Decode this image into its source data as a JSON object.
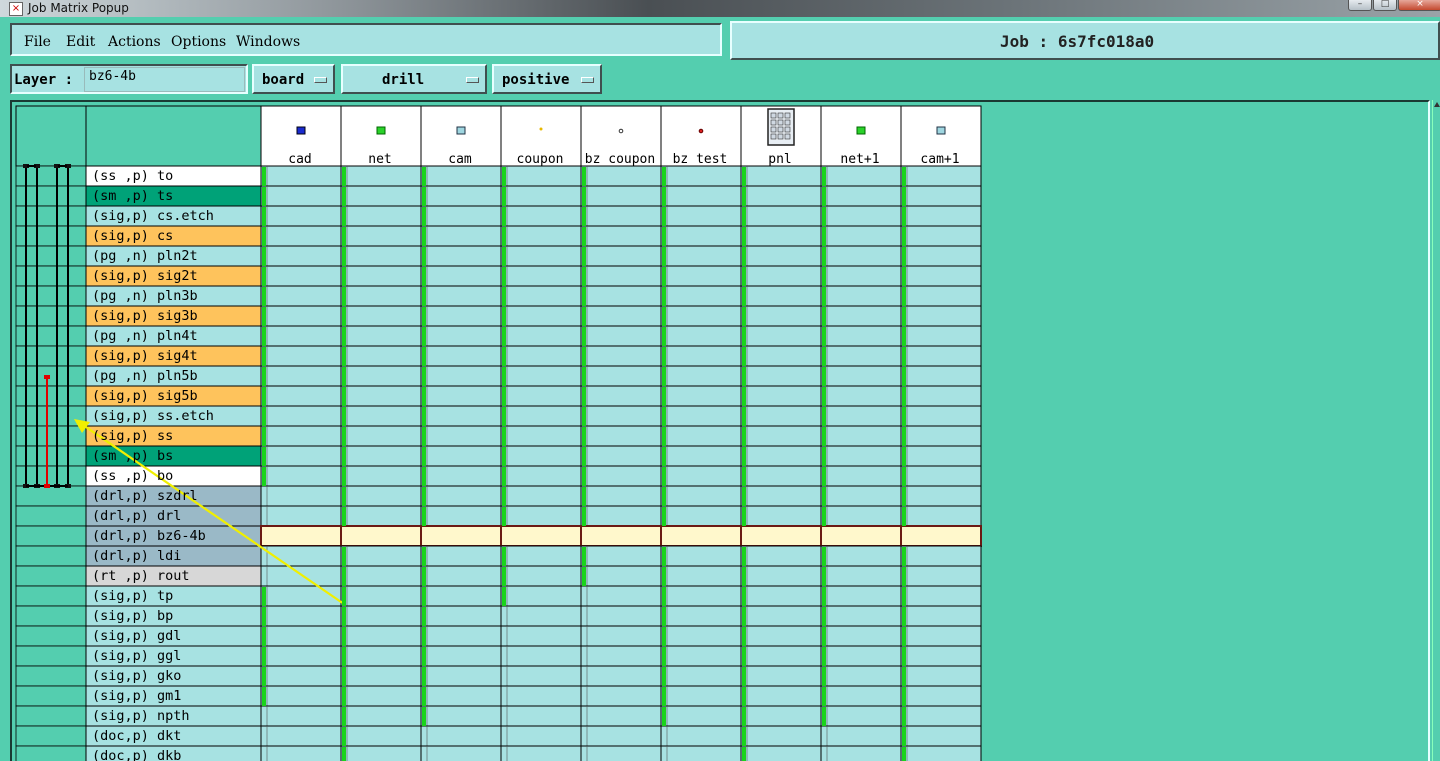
{
  "window": {
    "title": "Job Matrix Popup",
    "icon": "matrix-app-icon",
    "controls": [
      "minimize",
      "maximize",
      "close"
    ]
  },
  "menu": [
    "File",
    "Edit",
    "Actions",
    "Options",
    "Windows"
  ],
  "job": {
    "label": "Job",
    "separator": ":",
    "name": "6s7fc018a0"
  },
  "layer_field": {
    "label": "Layer :",
    "value": "bz6-4b"
  },
  "options": {
    "context": "board",
    "type": "drill",
    "polarity": "positive"
  },
  "steps": [
    {
      "name": "cad",
      "icon": "blue-square-icon"
    },
    {
      "name": "net",
      "icon": "green-square-icon"
    },
    {
      "name": "cam",
      "icon": "cyan-square-icon"
    },
    {
      "name": "coupon",
      "icon": "yellow-dot-icon"
    },
    {
      "name": "bz_coupon",
      "icon": "small-dot-icon"
    },
    {
      "name": "bz_test",
      "icon": "red-dot-icon"
    },
    {
      "name": "pnl",
      "icon": "panel-grid-icon"
    },
    {
      "name": "net+1",
      "icon": "green-square-icon"
    },
    {
      "name": "cam+1",
      "icon": "cyan-square-icon"
    }
  ],
  "colors": {
    "background": "#54ceaf",
    "cell": "#a7e2e2",
    "signal": "#fec35c",
    "mask": "#00a278",
    "silk": "#ffffff",
    "drill": "#9ab9c7",
    "rout": "#d7d7d7",
    "selected_cell": "#fff8cc",
    "tick": "#19d41c",
    "annotation": "#f0ef00",
    "drill_span": "#e00000"
  },
  "layers": [
    {
      "label": "(ss ,p) to",
      "kind": "silk",
      "ticks": [
        1,
        1,
        1,
        1,
        1,
        1,
        1,
        1,
        1
      ]
    },
    {
      "label": "(sm ,p) ts",
      "kind": "mask",
      "ticks": [
        1,
        1,
        1,
        1,
        1,
        1,
        1,
        1,
        1
      ]
    },
    {
      "label": "(sig,p) cs.etch",
      "kind": "plain",
      "ticks": [
        1,
        1,
        1,
        1,
        1,
        1,
        1,
        1,
        1
      ]
    },
    {
      "label": "(sig,p) cs",
      "kind": "signal",
      "ticks": [
        1,
        1,
        1,
        1,
        1,
        1,
        1,
        1,
        1
      ]
    },
    {
      "label": "(pg ,n) pln2t",
      "kind": "plain",
      "ticks": [
        1,
        1,
        1,
        1,
        1,
        1,
        1,
        1,
        1
      ]
    },
    {
      "label": "(sig,p) sig2t",
      "kind": "signal",
      "ticks": [
        1,
        1,
        1,
        1,
        1,
        1,
        1,
        1,
        1
      ]
    },
    {
      "label": "(pg ,n) pln3b",
      "kind": "plain",
      "ticks": [
        1,
        1,
        1,
        1,
        1,
        1,
        1,
        1,
        1
      ]
    },
    {
      "label": "(sig,p) sig3b",
      "kind": "signal",
      "ticks": [
        1,
        1,
        1,
        1,
        1,
        1,
        1,
        1,
        1
      ]
    },
    {
      "label": "(pg ,n) pln4t",
      "kind": "plain",
      "ticks": [
        1,
        1,
        1,
        1,
        1,
        1,
        1,
        1,
        1
      ]
    },
    {
      "label": "(sig,p) sig4t",
      "kind": "signal",
      "ticks": [
        1,
        1,
        1,
        1,
        1,
        1,
        1,
        1,
        1
      ]
    },
    {
      "label": "(pg ,n) pln5b",
      "kind": "plain",
      "ticks": [
        1,
        1,
        1,
        1,
        1,
        1,
        1,
        1,
        1
      ]
    },
    {
      "label": "(sig,p) sig5b",
      "kind": "signal",
      "ticks": [
        1,
        1,
        1,
        1,
        1,
        1,
        1,
        1,
        1
      ]
    },
    {
      "label": "(sig,p) ss.etch",
      "kind": "plain",
      "ticks": [
        1,
        1,
        1,
        1,
        1,
        1,
        1,
        1,
        1
      ]
    },
    {
      "label": "(sig,p) ss",
      "kind": "signal",
      "ticks": [
        1,
        1,
        1,
        1,
        1,
        1,
        1,
        1,
        1
      ]
    },
    {
      "label": "(sm ,p) bs",
      "kind": "mask",
      "ticks": [
        1,
        1,
        1,
        1,
        1,
        1,
        1,
        1,
        1
      ]
    },
    {
      "label": "(ss ,p) bo",
      "kind": "silk",
      "ticks": [
        1,
        1,
        1,
        1,
        1,
        1,
        1,
        1,
        1
      ]
    },
    {
      "label": "(drl,p) szdrl",
      "kind": "drill",
      "ticks": [
        0,
        1,
        1,
        1,
        1,
        1,
        1,
        1,
        1
      ]
    },
    {
      "label": "(drl,p) drl",
      "kind": "drill",
      "ticks": [
        0,
        1,
        1,
        1,
        1,
        1,
        1,
        1,
        1
      ]
    },
    {
      "label": "(drl,p) bz6-4b",
      "kind": "drill",
      "ticks": [
        0,
        0,
        0,
        0,
        0,
        0,
        0,
        0,
        0
      ],
      "selected": true
    },
    {
      "label": "(drl,p) ldi",
      "kind": "drill",
      "ticks": [
        0,
        1,
        1,
        1,
        1,
        1,
        1,
        1,
        1
      ]
    },
    {
      "label": "(rt ,p) rout",
      "kind": "rout",
      "ticks": [
        0,
        1,
        1,
        1,
        1,
        1,
        1,
        1,
        1
      ]
    },
    {
      "label": "(sig,p) tp",
      "kind": "plain",
      "ticks": [
        1,
        1,
        1,
        1,
        0,
        1,
        1,
        1,
        1
      ]
    },
    {
      "label": "(sig,p) bp",
      "kind": "plain",
      "ticks": [
        1,
        1,
        1,
        0,
        0,
        1,
        1,
        1,
        1
      ]
    },
    {
      "label": "(sig,p) gdl",
      "kind": "plain",
      "ticks": [
        1,
        1,
        1,
        0,
        0,
        1,
        1,
        1,
        1
      ]
    },
    {
      "label": "(sig,p) ggl",
      "kind": "plain",
      "ticks": [
        1,
        1,
        1,
        0,
        0,
        1,
        1,
        1,
        1
      ]
    },
    {
      "label": "(sig,p) gko",
      "kind": "plain",
      "ticks": [
        1,
        1,
        1,
        0,
        0,
        1,
        1,
        1,
        1
      ]
    },
    {
      "label": "(sig,p) gm1",
      "kind": "plain",
      "ticks": [
        1,
        1,
        1,
        0,
        0,
        1,
        1,
        1,
        1
      ]
    },
    {
      "label": "(sig,p) npth",
      "kind": "plain",
      "ticks": [
        0,
        1,
        1,
        0,
        0,
        1,
        1,
        1,
        1
      ]
    },
    {
      "label": "(doc,p) dkt",
      "kind": "plain",
      "ticks": [
        0,
        1,
        0,
        0,
        0,
        0,
        1,
        0,
        1
      ]
    },
    {
      "label": "(doc,p) dkb",
      "kind": "plain",
      "ticks": [
        0,
        1,
        0,
        0,
        0,
        0,
        1,
        0,
        1
      ]
    }
  ]
}
